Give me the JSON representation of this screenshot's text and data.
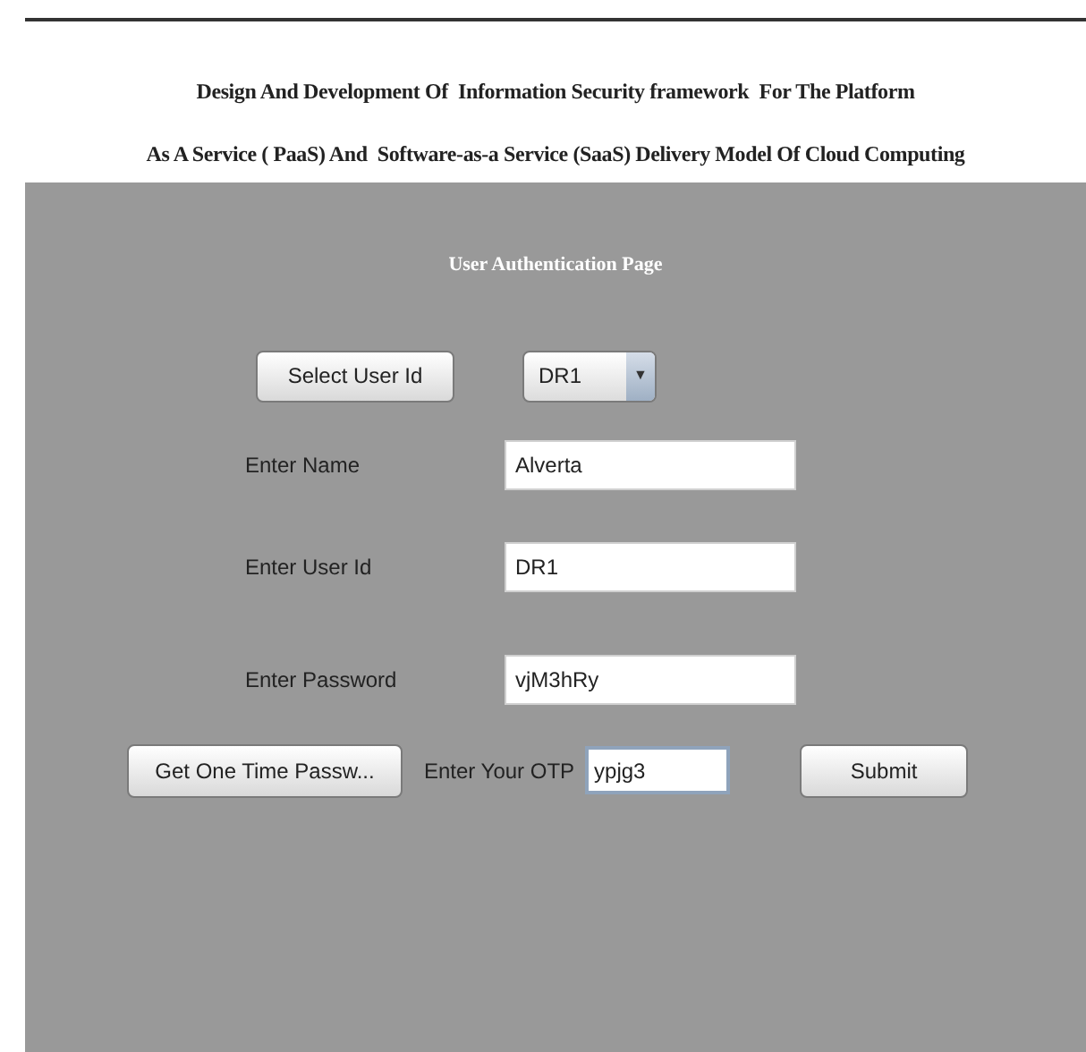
{
  "header": {
    "title_lines": [
      "Design And Development Of  Information Security framework  For The Platform",
      "As A Service ( PaaS) And  Software-as-a Service (SaaS) Delivery Model Of Cloud Computing"
    ]
  },
  "panel": {
    "title": "User Authentication Page",
    "select_user": {
      "button": "Select User Id",
      "dropdown_value": "DR1",
      "arrow": "▼"
    },
    "fields": [
      {
        "label": "Enter Name",
        "value": "Alverta"
      },
      {
        "label": "Enter User Id",
        "value": "DR1"
      },
      {
        "label": "Enter Password",
        "value": "vjM3hRy"
      }
    ],
    "otp_row": {
      "button": "Get One Time Passw...",
      "label": "Enter Your OTP",
      "value": "ypjg3",
      "submit": "Submit"
    }
  }
}
